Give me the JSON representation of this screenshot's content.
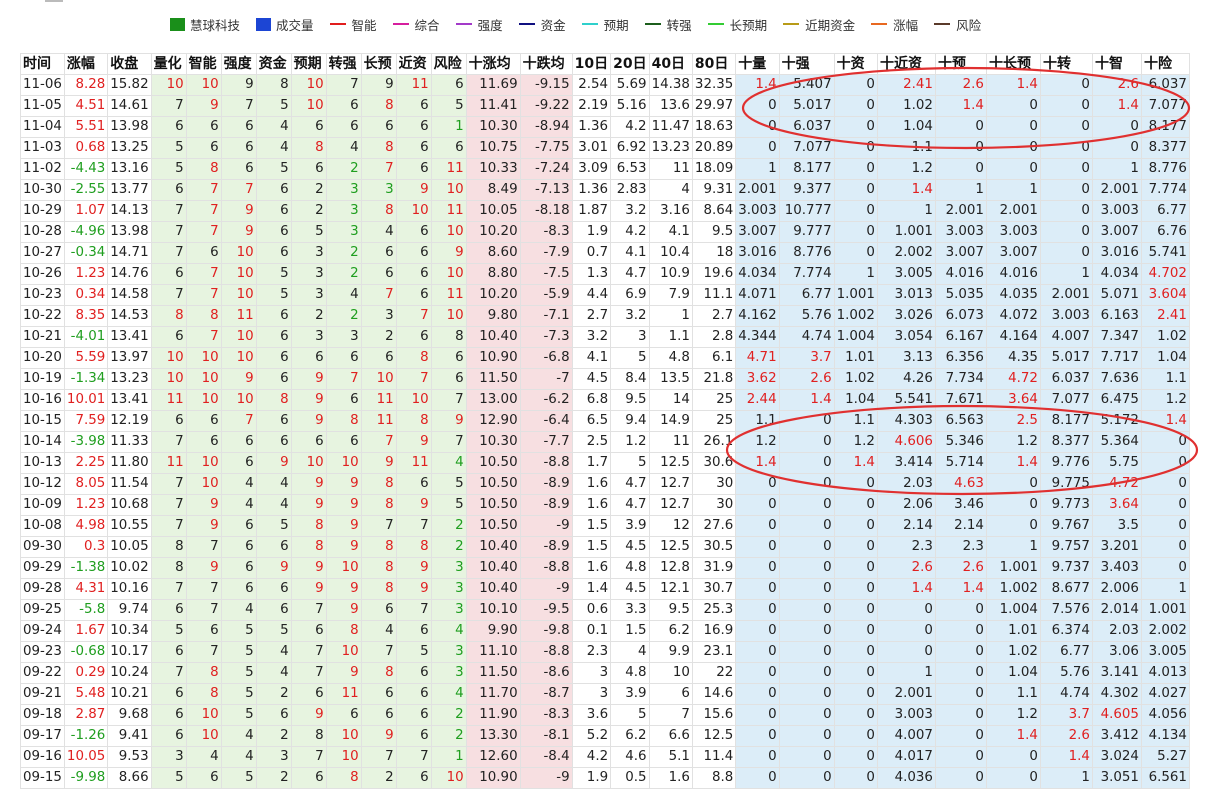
{
  "legend": [
    {
      "label": "慧球科技",
      "shape": "box",
      "color": "#1a8f1a"
    },
    {
      "label": "成交量",
      "shape": "box",
      "color": "#1c45d4"
    },
    {
      "label": "智能",
      "shape": "line",
      "color": "#e11d1d"
    },
    {
      "label": "综合",
      "shape": "line",
      "color": "#d61e9e"
    },
    {
      "label": "强度",
      "shape": "line",
      "color": "#a33ac9"
    },
    {
      "label": "资金",
      "shape": "line",
      "color": "#101080"
    },
    {
      "label": "预期",
      "shape": "line",
      "color": "#2fd0cc"
    },
    {
      "label": "转强",
      "shape": "line",
      "color": "#1c5e1c"
    },
    {
      "label": "长预期",
      "shape": "line",
      "color": "#33cc33"
    },
    {
      "label": "近期资金",
      "shape": "line",
      "color": "#b89b17"
    },
    {
      "label": "涨幅",
      "shape": "line",
      "color": "#e86820"
    },
    {
      "label": "风险",
      "shape": "line",
      "color": "#5a3a2a"
    }
  ],
  "headers": [
    "时间",
    "涨幅",
    "收盘",
    "量化",
    "智能",
    "强度",
    "资金",
    "预期",
    "转强",
    "长预",
    "近资",
    "风险",
    "十涨均",
    "十跌均",
    "10日",
    "20日",
    "40日",
    "80日",
    "十量",
    "十强",
    "十资",
    "十近资",
    "十预",
    "十长预",
    "十转",
    "十智",
    "十险"
  ],
  "colors": {
    "red": "#e02020",
    "green": "#1f9e1f",
    "annotation": "#e03030"
  },
  "rows": [
    {
      "c": [
        "11-06",
        "8.28",
        "15.82",
        "10",
        "10",
        "9",
        "8",
        "10",
        "7",
        "9",
        "11",
        "6",
        "11.69",
        "-9.15",
        "2.54",
        "5.69",
        "14.38",
        "32.35",
        "1.4",
        "5.407",
        "0",
        "2.41",
        "2.6",
        "1.4",
        "0",
        "2.6",
        "6.037"
      ],
      "red": [
        1,
        3,
        4,
        7,
        10,
        18,
        21,
        22,
        23,
        25
      ]
    },
    {
      "c": [
        "11-05",
        "4.51",
        "14.61",
        "7",
        "9",
        "7",
        "5",
        "10",
        "6",
        "8",
        "6",
        "5",
        "11.41",
        "-9.22",
        "2.19",
        "5.16",
        "13.6",
        "29.97",
        "0",
        "5.017",
        "0",
        "1.02",
        "1.4",
        "0",
        "0",
        "1.4",
        "7.077"
      ],
      "red": [
        1,
        4,
        7,
        9,
        22,
        25
      ]
    },
    {
      "c": [
        "11-04",
        "5.51",
        "13.98",
        "6",
        "6",
        "6",
        "4",
        "6",
        "6",
        "6",
        "6",
        "1",
        "10.30",
        "-8.94",
        "1.36",
        "4.2",
        "11.47",
        "18.63",
        "0",
        "6.037",
        "0",
        "1.04",
        "0",
        "0",
        "0",
        "0",
        "8.177"
      ],
      "red": [
        1
      ],
      "green": [
        11
      ]
    },
    {
      "c": [
        "11-03",
        "0.68",
        "13.25",
        "5",
        "6",
        "6",
        "4",
        "8",
        "4",
        "8",
        "6",
        "6",
        "10.75",
        "-7.75",
        "3.01",
        "6.92",
        "13.23",
        "20.89",
        "0",
        "7.077",
        "0",
        "1.1",
        "0",
        "0",
        "0",
        "0",
        "8.377"
      ],
      "red": [
        1,
        7,
        9
      ]
    },
    {
      "c": [
        "11-02",
        "-4.43",
        "13.16",
        "5",
        "8",
        "6",
        "5",
        "6",
        "2",
        "7",
        "6",
        "11",
        "10.33",
        "-7.24",
        "3.09",
        "6.53",
        "11",
        "18.09",
        "1",
        "8.177",
        "0",
        "1.2",
        "0",
        "0",
        "0",
        "1",
        "8.776"
      ],
      "red": [
        4,
        9,
        11
      ],
      "green": [
        1,
        8
      ]
    },
    {
      "c": [
        "10-30",
        "-2.55",
        "13.77",
        "6",
        "7",
        "7",
        "6",
        "2",
        "3",
        "3",
        "9",
        "10",
        "8.49",
        "-7.13",
        "1.36",
        "2.83",
        "4",
        "9.31",
        "2.001",
        "9.377",
        "0",
        "1.4",
        "1",
        "1",
        "0",
        "2.001",
        "7.774"
      ],
      "red": [
        4,
        5,
        10,
        11,
        21
      ],
      "green": [
        1,
        8,
        9
      ]
    },
    {
      "c": [
        "10-29",
        "1.07",
        "14.13",
        "7",
        "7",
        "9",
        "6",
        "2",
        "3",
        "8",
        "10",
        "11",
        "10.05",
        "-8.18",
        "1.87",
        "3.2",
        "3.16",
        "8.64",
        "3.003",
        "10.777",
        "0",
        "1",
        "2.001",
        "2.001",
        "0",
        "3.003",
        "6.77"
      ],
      "red": [
        1,
        4,
        5,
        9,
        10,
        11
      ],
      "green": [
        8
      ]
    },
    {
      "c": [
        "10-28",
        "-4.96",
        "13.98",
        "7",
        "7",
        "9",
        "6",
        "5",
        "3",
        "4",
        "6",
        "10",
        "10.20",
        "-8.3",
        "1.9",
        "4.2",
        "4.1",
        "9.5",
        "3.007",
        "9.777",
        "0",
        "1.001",
        "3.003",
        "3.003",
        "0",
        "3.007",
        "6.76"
      ],
      "red": [
        4,
        5,
        11
      ],
      "green": [
        1,
        8
      ]
    },
    {
      "c": [
        "10-27",
        "-0.34",
        "14.71",
        "7",
        "6",
        "10",
        "6",
        "3",
        "2",
        "6",
        "6",
        "9",
        "8.60",
        "-7.9",
        "0.7",
        "4.1",
        "10.4",
        "18",
        "3.016",
        "8.776",
        "0",
        "2.002",
        "3.007",
        "3.007",
        "0",
        "3.016",
        "5.741"
      ],
      "red": [
        5,
        11
      ],
      "green": [
        1,
        8
      ]
    },
    {
      "c": [
        "10-26",
        "1.23",
        "14.76",
        "6",
        "7",
        "10",
        "5",
        "3",
        "2",
        "6",
        "6",
        "10",
        "8.80",
        "-7.5",
        "1.3",
        "4.7",
        "10.9",
        "19.6",
        "4.034",
        "7.774",
        "1",
        "3.005",
        "4.016",
        "4.016",
        "1",
        "4.034",
        "4.702"
      ],
      "red": [
        1,
        4,
        5,
        11,
        26
      ],
      "green": [
        8
      ]
    },
    {
      "c": [
        "10-23",
        "0.34",
        "14.58",
        "7",
        "7",
        "10",
        "5",
        "3",
        "4",
        "7",
        "6",
        "11",
        "10.20",
        "-5.9",
        "4.4",
        "6.9",
        "7.9",
        "11.1",
        "4.071",
        "6.77",
        "1.001",
        "3.013",
        "5.035",
        "4.035",
        "2.001",
        "5.071",
        "3.604"
      ],
      "red": [
        1,
        4,
        5,
        9,
        11,
        26
      ]
    },
    {
      "c": [
        "10-22",
        "8.35",
        "14.53",
        "8",
        "8",
        "11",
        "6",
        "2",
        "2",
        "3",
        "7",
        "10",
        "9.80",
        "-7.1",
        "2.7",
        "3.2",
        "1",
        "2.7",
        "4.162",
        "5.76",
        "1.002",
        "3.026",
        "6.073",
        "4.072",
        "3.003",
        "6.163",
        "2.41"
      ],
      "red": [
        1,
        3,
        4,
        5,
        10,
        11,
        26
      ],
      "green": [
        8
      ]
    },
    {
      "c": [
        "10-21",
        "-4.01",
        "13.41",
        "6",
        "7",
        "10",
        "6",
        "3",
        "3",
        "2",
        "6",
        "8",
        "10.40",
        "-7.3",
        "3.2",
        "3",
        "1.1",
        "2.8",
        "4.344",
        "4.74",
        "1.004",
        "3.054",
        "6.167",
        "4.164",
        "4.007",
        "7.347",
        "1.02"
      ],
      "red": [
        4,
        5
      ],
      "green": [
        1
      ]
    },
    {
      "c": [
        "10-20",
        "5.59",
        "13.97",
        "10",
        "10",
        "10",
        "6",
        "6",
        "6",
        "6",
        "8",
        "6",
        "10.90",
        "-6.8",
        "4.1",
        "5",
        "4.8",
        "6.1",
        "4.71",
        "3.7",
        "1.01",
        "3.13",
        "6.356",
        "4.35",
        "5.017",
        "7.717",
        "1.04"
      ],
      "red": [
        1,
        3,
        4,
        5,
        10,
        18,
        19
      ]
    },
    {
      "c": [
        "10-19",
        "-1.34",
        "13.23",
        "10",
        "10",
        "9",
        "6",
        "9",
        "7",
        "10",
        "7",
        "6",
        "11.50",
        "-7",
        "4.5",
        "8.4",
        "13.5",
        "21.8",
        "3.62",
        "2.6",
        "1.02",
        "4.26",
        "7.734",
        "4.72",
        "6.037",
        "7.636",
        "1.1"
      ],
      "red": [
        3,
        4,
        5,
        7,
        8,
        9,
        10,
        18,
        19,
        23
      ],
      "green": [
        1
      ]
    },
    {
      "c": [
        "10-16",
        "10.01",
        "13.41",
        "11",
        "10",
        "10",
        "8",
        "9",
        "6",
        "11",
        "10",
        "7",
        "13.00",
        "-6.2",
        "6.8",
        "9.5",
        "14",
        "25",
        "2.44",
        "1.4",
        "1.04",
        "5.541",
        "7.671",
        "3.64",
        "7.077",
        "6.475",
        "1.2"
      ],
      "red": [
        1,
        3,
        4,
        5,
        6,
        7,
        9,
        10,
        18,
        19,
        23
      ]
    },
    {
      "c": [
        "10-15",
        "7.59",
        "12.19",
        "6",
        "6",
        "7",
        "6",
        "9",
        "8",
        "11",
        "8",
        "9",
        "12.90",
        "-6.4",
        "6.5",
        "9.4",
        "14.9",
        "25",
        "1.1",
        "0",
        "1.1",
        "4.303",
        "6.563",
        "2.5",
        "8.177",
        "5.172",
        "1.4"
      ],
      "red": [
        1,
        5,
        7,
        8,
        9,
        10,
        11,
        23,
        26
      ]
    },
    {
      "c": [
        "10-14",
        "-3.98",
        "11.33",
        "7",
        "6",
        "6",
        "6",
        "6",
        "6",
        "7",
        "9",
        "7",
        "10.30",
        "-7.7",
        "2.5",
        "1.2",
        "11",
        "26.1",
        "1.2",
        "0",
        "1.2",
        "4.606",
        "5.346",
        "1.2",
        "8.377",
        "5.364",
        "0"
      ],
      "red": [
        9,
        10,
        21
      ],
      "green": [
        1
      ]
    },
    {
      "c": [
        "10-13",
        "2.25",
        "11.80",
        "11",
        "10",
        "6",
        "9",
        "10",
        "10",
        "9",
        "11",
        "4",
        "10.50",
        "-8.8",
        "1.7",
        "5",
        "12.5",
        "30.6",
        "1.4",
        "0",
        "1.4",
        "3.414",
        "5.714",
        "1.4",
        "9.776",
        "5.75",
        "0"
      ],
      "red": [
        1,
        3,
        4,
        6,
        7,
        8,
        9,
        10,
        18,
        20,
        23
      ],
      "green": [
        11
      ]
    },
    {
      "c": [
        "10-12",
        "8.05",
        "11.54",
        "7",
        "10",
        "4",
        "4",
        "9",
        "9",
        "8",
        "6",
        "5",
        "10.50",
        "-8.9",
        "1.6",
        "4.7",
        "12.7",
        "30",
        "0",
        "0",
        "0",
        "2.03",
        "4.63",
        "0",
        "9.775",
        "4.72",
        "0"
      ],
      "red": [
        1,
        4,
        7,
        8,
        9,
        22,
        25
      ]
    },
    {
      "c": [
        "10-09",
        "1.23",
        "10.68",
        "7",
        "9",
        "4",
        "4",
        "9",
        "9",
        "8",
        "9",
        "5",
        "10.50",
        "-8.9",
        "1.6",
        "4.7",
        "12.7",
        "30",
        "0",
        "0",
        "0",
        "2.06",
        "3.46",
        "0",
        "9.773",
        "3.64",
        "0"
      ],
      "red": [
        1,
        4,
        7,
        8,
        9,
        10,
        25
      ]
    },
    {
      "c": [
        "10-08",
        "4.98",
        "10.55",
        "7",
        "9",
        "6",
        "5",
        "8",
        "9",
        "7",
        "7",
        "2",
        "10.50",
        "-9",
        "1.5",
        "3.9",
        "12",
        "27.6",
        "0",
        "0",
        "0",
        "2.14",
        "2.14",
        "0",
        "9.767",
        "3.5",
        "0"
      ],
      "red": [
        1,
        4,
        7,
        8
      ],
      "green": [
        11
      ]
    },
    {
      "c": [
        "09-30",
        "0.3",
        "10.05",
        "8",
        "7",
        "6",
        "6",
        "8",
        "9",
        "8",
        "8",
        "2",
        "10.40",
        "-8.9",
        "1.5",
        "4.5",
        "12.5",
        "30.5",
        "0",
        "0",
        "0",
        "2.3",
        "2.3",
        "1",
        "9.757",
        "3.201",
        "0"
      ],
      "red": [
        1,
        7,
        8,
        9,
        10
      ],
      "green": [
        11
      ]
    },
    {
      "c": [
        "09-29",
        "-1.38",
        "10.02",
        "8",
        "9",
        "6",
        "9",
        "9",
        "10",
        "8",
        "9",
        "3",
        "10.40",
        "-8.8",
        "1.6",
        "4.8",
        "12.8",
        "31.9",
        "0",
        "0",
        "0",
        "2.6",
        "2.6",
        "1.001",
        "9.737",
        "3.403",
        "0"
      ],
      "red": [
        4,
        6,
        7,
        8,
        9,
        10,
        21,
        22
      ],
      "green": [
        1,
        11
      ]
    },
    {
      "c": [
        "09-28",
        "4.31",
        "10.16",
        "7",
        "7",
        "6",
        "6",
        "9",
        "9",
        "8",
        "9",
        "3",
        "10.40",
        "-9",
        "1.4",
        "4.5",
        "12.1",
        "30.7",
        "0",
        "0",
        "0",
        "1.4",
        "1.4",
        "1.002",
        "8.677",
        "2.006",
        "1"
      ],
      "red": [
        1,
        7,
        8,
        9,
        10,
        21,
        22
      ],
      "green": [
        11
      ]
    },
    {
      "c": [
        "09-25",
        "-5.8",
        "9.74",
        "6",
        "7",
        "4",
        "6",
        "7",
        "9",
        "6",
        "7",
        "3",
        "10.10",
        "-9.5",
        "0.6",
        "3.3",
        "9.5",
        "25.3",
        "0",
        "0",
        "0",
        "0",
        "0",
        "1.004",
        "7.576",
        "2.014",
        "1.001"
      ],
      "red": [
        8
      ],
      "green": [
        1,
        11
      ]
    },
    {
      "c": [
        "09-24",
        "1.67",
        "10.34",
        "5",
        "6",
        "5",
        "5",
        "6",
        "8",
        "4",
        "6",
        "4",
        "9.90",
        "-9.8",
        "0.1",
        "1.5",
        "6.2",
        "16.9",
        "0",
        "0",
        "0",
        "0",
        "0",
        "1.01",
        "6.374",
        "2.03",
        "2.002"
      ],
      "red": [
        1,
        8
      ],
      "green": [
        11
      ]
    },
    {
      "c": [
        "09-23",
        "-0.68",
        "10.17",
        "6",
        "7",
        "5",
        "4",
        "7",
        "10",
        "7",
        "5",
        "3",
        "11.10",
        "-8.8",
        "2.3",
        "4",
        "9.9",
        "23.1",
        "0",
        "0",
        "0",
        "0",
        "0",
        "1.02",
        "6.77",
        "3.06",
        "3.005"
      ],
      "red": [
        8
      ],
      "green": [
        1,
        11
      ]
    },
    {
      "c": [
        "09-22",
        "0.29",
        "10.24",
        "7",
        "8",
        "5",
        "4",
        "7",
        "9",
        "8",
        "6",
        "3",
        "11.50",
        "-8.6",
        "3",
        "4.8",
        "10",
        "22",
        "0",
        "0",
        "0",
        "1",
        "0",
        "1.04",
        "5.76",
        "3.141",
        "4.013"
      ],
      "red": [
        1,
        4,
        8,
        9
      ],
      "green": [
        11
      ]
    },
    {
      "c": [
        "09-21",
        "5.48",
        "10.21",
        "6",
        "8",
        "5",
        "2",
        "6",
        "11",
        "6",
        "6",
        "4",
        "11.70",
        "-8.7",
        "3",
        "3.9",
        "6",
        "14.6",
        "0",
        "0",
        "0",
        "2.001",
        "0",
        "1.1",
        "4.74",
        "4.302",
        "4.027"
      ],
      "red": [
        1,
        4,
        8
      ],
      "green": [
        11
      ]
    },
    {
      "c": [
        "09-18",
        "2.87",
        "9.68",
        "6",
        "10",
        "5",
        "6",
        "9",
        "6",
        "6",
        "6",
        "2",
        "11.90",
        "-8.3",
        "3.6",
        "5",
        "7",
        "15.6",
        "0",
        "0",
        "0",
        "3.003",
        "0",
        "1.2",
        "3.7",
        "4.605",
        "4.056"
      ],
      "red": [
        1,
        4,
        7,
        24,
        25
      ],
      "green": [
        11
      ]
    },
    {
      "c": [
        "09-17",
        "-1.26",
        "9.41",
        "6",
        "10",
        "4",
        "2",
        "8",
        "10",
        "9",
        "6",
        "2",
        "13.30",
        "-8.1",
        "5.2",
        "6.2",
        "6.6",
        "12.5",
        "0",
        "0",
        "0",
        "4.007",
        "0",
        "1.4",
        "2.6",
        "3.412",
        "4.134"
      ],
      "red": [
        4,
        8,
        9,
        23,
        24
      ],
      "green": [
        1,
        11
      ]
    },
    {
      "c": [
        "09-16",
        "10.05",
        "9.53",
        "3",
        "4",
        "4",
        "3",
        "7",
        "10",
        "7",
        "7",
        "1",
        "12.60",
        "-8.4",
        "4.2",
        "4.6",
        "5.1",
        "11.4",
        "0",
        "0",
        "0",
        "4.017",
        "0",
        "0",
        "1.4",
        "3.024",
        "5.27"
      ],
      "red": [
        1,
        8,
        24
      ],
      "green": [
        11
      ]
    },
    {
      "c": [
        "09-15",
        "-9.98",
        "8.66",
        "5",
        "6",
        "5",
        "2",
        "6",
        "8",
        "2",
        "6",
        "10",
        "10.90",
        "-9",
        "1.9",
        "0.5",
        "1.6",
        "8.8",
        "0",
        "0",
        "0",
        "4.036",
        "0",
        "0",
        "1",
        "3.051",
        "6.561"
      ],
      "red": [
        8,
        11
      ],
      "green": [
        1
      ]
    }
  ]
}
